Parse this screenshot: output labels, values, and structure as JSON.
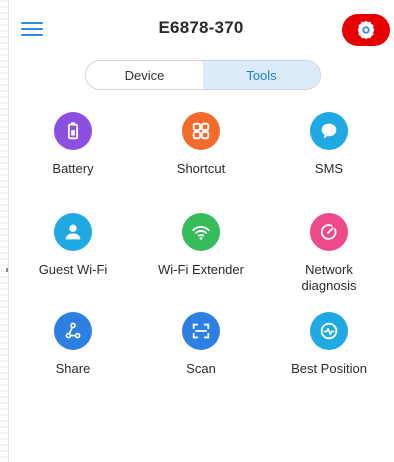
{
  "header": {
    "title": "E6878-370"
  },
  "tabs": [
    {
      "label": "Device",
      "active": false
    },
    {
      "label": "Tools",
      "active": true
    }
  ],
  "tools": [
    {
      "label": "Battery",
      "icon": "battery-icon",
      "color": "#8c4fe0"
    },
    {
      "label": "Shortcut",
      "icon": "shortcut-icon",
      "color": "#f36b2a"
    },
    {
      "label": "SMS",
      "icon": "sms-icon",
      "color": "#1fa9e3"
    },
    {
      "label": "Guest Wi-Fi",
      "icon": "guest-user-icon",
      "color": "#1fa9e3"
    },
    {
      "label": "Wi-Fi Extender",
      "icon": "wifi-extender-icon",
      "color": "#36bc5a"
    },
    {
      "label": "Network\ndiagnosis",
      "icon": "network-diagnosis-icon",
      "color": "#ee4a8a"
    },
    {
      "label": "Share",
      "icon": "share-icon",
      "color": "#2e7fe2"
    },
    {
      "label": "Scan",
      "icon": "scan-icon",
      "color": "#2e7fe2"
    },
    {
      "label": "Best Position",
      "icon": "best-position-icon",
      "color": "#1fa9e3"
    }
  ],
  "colors": {
    "accent": "#2f8ee0",
    "highlight": "#e60000"
  }
}
